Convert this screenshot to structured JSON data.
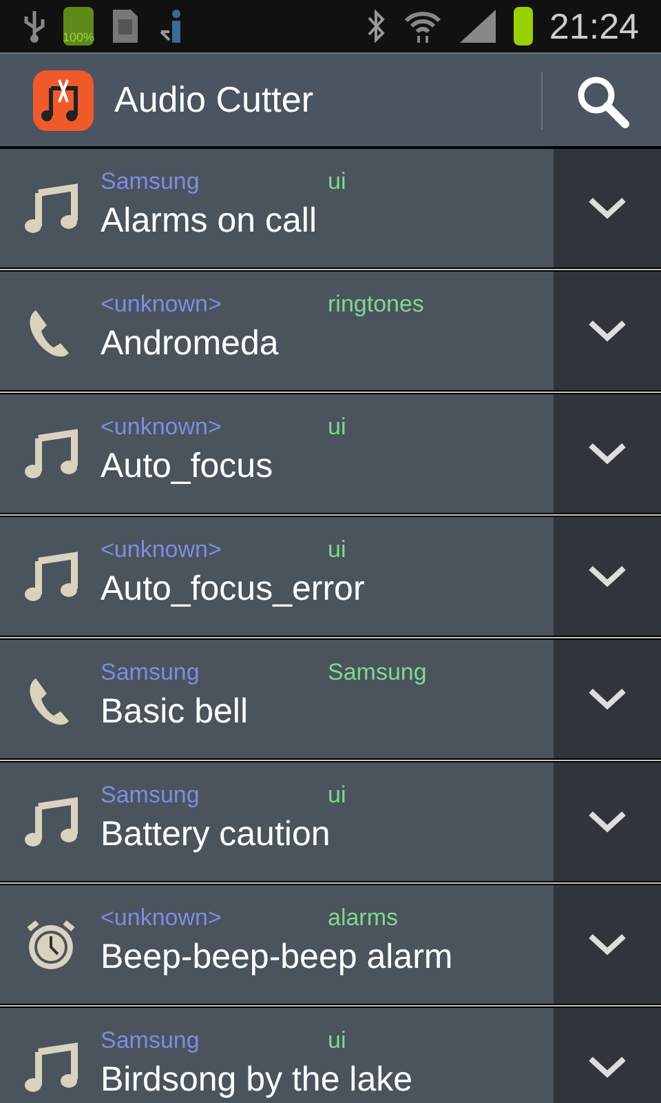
{
  "status_bar": {
    "battery_badge": "100%",
    "time": "21:24"
  },
  "action_bar": {
    "title": "Audio Cutter"
  },
  "rows": [
    {
      "kind": "music",
      "artist": "Samsung",
      "category": "ui",
      "title": "Alarms on call"
    },
    {
      "kind": "ringtone",
      "artist": "<unknown>",
      "category": "ringtones",
      "title": "Andromeda"
    },
    {
      "kind": "music",
      "artist": "<unknown>",
      "category": "ui",
      "title": "Auto_focus"
    },
    {
      "kind": "music",
      "artist": "<unknown>",
      "category": "ui",
      "title": "Auto_focus_error"
    },
    {
      "kind": "ringtone",
      "artist": "Samsung",
      "category": "Samsung",
      "title": "Basic bell"
    },
    {
      "kind": "music",
      "artist": "Samsung",
      "category": "ui",
      "title": "Battery caution"
    },
    {
      "kind": "alarm",
      "artist": "<unknown>",
      "category": "alarms",
      "title": "Beep-beep-beep alarm"
    },
    {
      "kind": "music",
      "artist": "Samsung",
      "category": "ui",
      "title": "Birdsong by the lake"
    }
  ]
}
